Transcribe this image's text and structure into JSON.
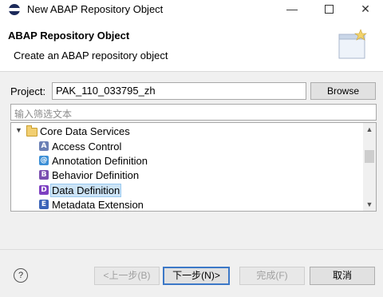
{
  "window": {
    "title": "New ABAP Repository Object"
  },
  "banner": {
    "title": "ABAP Repository Object",
    "description": "Create an ABAP repository object"
  },
  "project": {
    "label": "Project:",
    "value": "PAK_110_033795_zh",
    "browse_label": "Browse"
  },
  "filter": {
    "placeholder": "输入筛选文本"
  },
  "tree": {
    "folder": {
      "label": "Core Data Services",
      "icon": "folder-open-icon",
      "expanded": true
    },
    "items": [
      {
        "label": "Access Control",
        "icon": "access-control-icon",
        "color": "#6a7fb5",
        "glyph": "A"
      },
      {
        "label": "Annotation Definition",
        "icon": "annotation-definition-icon",
        "color": "#3c8fd6",
        "glyph": "@"
      },
      {
        "label": "Behavior Definition",
        "icon": "behavior-definition-icon",
        "color": "#7a4fb0",
        "glyph": "B"
      },
      {
        "label": "Data Definition",
        "icon": "data-definition-icon",
        "color": "#7d3fc1",
        "glyph": "D",
        "selected": true
      },
      {
        "label": "Metadata Extension",
        "icon": "metadata-extension-icon",
        "color": "#3a63b8",
        "glyph": "E"
      }
    ]
  },
  "buttons": {
    "back": "<上一步(B)",
    "next": "下一步(N)>",
    "finish": "完成(F)",
    "cancel": "取消"
  },
  "colors": {
    "selection": "#cce4f7",
    "default_button_border": "#3c78c7"
  }
}
